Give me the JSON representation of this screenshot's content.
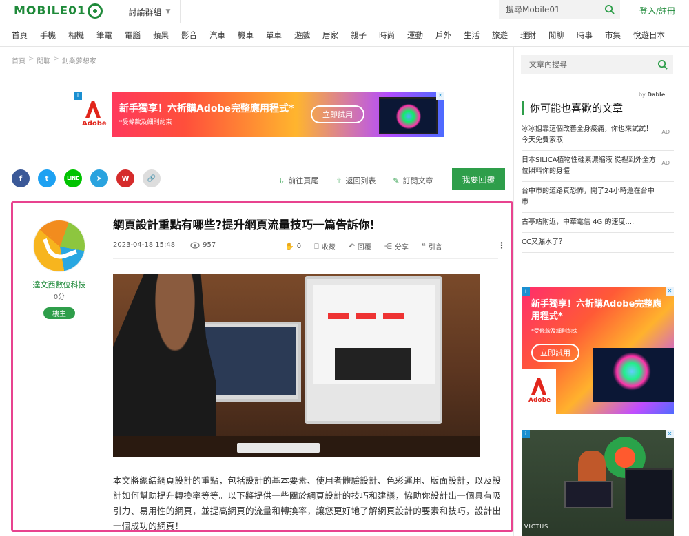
{
  "header": {
    "logo_text": "MOBILE01",
    "forum_menu_label": "討論群組",
    "search_placeholder": "搜尋Mobile01",
    "login_label": "登入/註冊"
  },
  "nav": {
    "items": [
      "首頁",
      "手機",
      "相機",
      "筆電",
      "電腦",
      "蘋果",
      "影音",
      "汽車",
      "機車",
      "單車",
      "遊戲",
      "居家",
      "親子",
      "時尚",
      "運動",
      "戶外",
      "生活",
      "旅遊",
      "理財",
      "閒聊",
      "時事",
      "市集",
      "悅遊日本"
    ]
  },
  "breadcrumb": {
    "items": [
      "首頁",
      "閒聊",
      "創業夢想家"
    ],
    "separator": ">"
  },
  "top_ad": {
    "brand": "Adobe",
    "headline": "新手獨享！六折購Adobe完整應用程式*",
    "sub": "*受條款及細則約束",
    "cta": "立即試用",
    "close": "✕"
  },
  "social": {
    "facebook": "f",
    "twitter": "t",
    "line": "LINE",
    "telegram": "➤",
    "weibo": "W",
    "link": "🔗"
  },
  "toolbar": {
    "last_page": "前往頁尾",
    "back_list": "返回列表",
    "subscribe": "訂閱文章",
    "reply": "我要回覆"
  },
  "post": {
    "author": "達文西數位科技",
    "score": "0分",
    "badge": "樓主",
    "title": "網頁設計重點有哪些?提升網頁流量技巧一篇告訴你!",
    "date": "2023-04-18 15:48",
    "views": "957",
    "likes": "0",
    "collect": "收藏",
    "reply": "回覆",
    "share": "分享",
    "quote": "引言",
    "more": "⋮",
    "body": "本文將總結網頁設計的重點，包括設計的基本要素、使用者體驗設計、色彩運用、版面設計，以及設計如何幫助提升轉換率等等。以下將提供一些關於網頁設計的技巧和建議，協助你設計出一個具有吸引力、易用性的網頁，並提高網頁的流量和轉換率，讓您更好地了解網頁設計的要素和技巧，設計出一個成功的網頁！"
  },
  "sidebar": {
    "search_placeholder": "文章內搜尋",
    "dable_prefix": "by",
    "dable_brand": "Dable",
    "rec_title": "你可能也喜歡的文章",
    "recommendations": [
      {
        "text": "冰冰姐靠這個改善全身痠痛，你也來試試！今天免費索取",
        "ad": "AD"
      },
      {
        "text": "日本SILICA植物性硅素濃縮液 從裡到外全方位照料你的身體",
        "ad": "AD"
      },
      {
        "text": "台中市的道路真恐怖，開了24小時還在台中市",
        "ad": ""
      },
      {
        "text": "古亭站附近，中華電信 4G 的速度....",
        "ad": ""
      },
      {
        "text": "CC又漏水了？",
        "ad": ""
      }
    ],
    "ad1": {
      "headline": "新手獨享！六折購Adobe完整應用程式*",
      "sub": "*受條款及細則約束",
      "cta": "立即試用",
      "brand": "Adobe"
    },
    "ad2": {
      "brand": "VICTUS"
    }
  },
  "colors": {
    "brand_green": "#2e9e4a",
    "highlight_pink": "#e8438f"
  }
}
